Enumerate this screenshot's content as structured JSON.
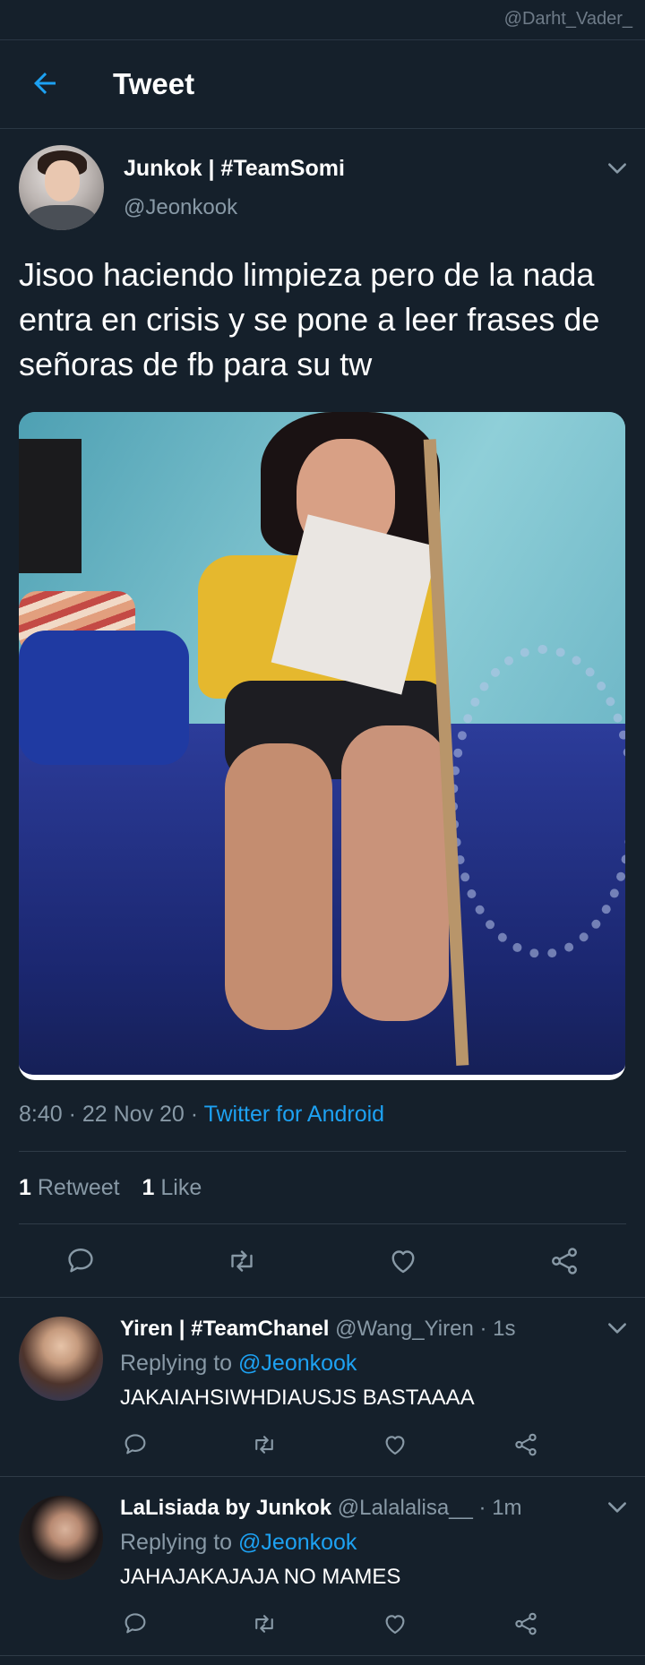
{
  "watermark": "@Darht_Vader_",
  "header": {
    "title": "Tweet",
    "back_icon": "arrow-left-icon"
  },
  "tweet": {
    "author_name": "Junkok | #TeamSomi",
    "author_handle": "@Jeonkook",
    "text": "Jisoo haciendo limpieza pero de la nada entra en crisis y se pone a leer frases de señoras de fb para su tw",
    "time": "8:40 · 22 Nov 20 · ",
    "source": "Twitter for Android",
    "retweets": "1",
    "retweets_label": "Retweet",
    "likes": "1",
    "likes_label": "Like"
  },
  "replies": [
    {
      "name": "Yiren | #TeamChanel",
      "handle": "@Wang_Yiren · 1s",
      "replying_prefix": "Replying to ",
      "replying_to": "@Jeonkook",
      "text": "JAKAIAHSIWHDIAUSJS BASTAAAA"
    },
    {
      "name": "LaLisiada by Junkok",
      "handle": "@Lalalalisa__ · 1m",
      "replying_prefix": "Replying to ",
      "replying_to": "@Jeonkook",
      "text": "JAHAJAKAJAJA NO MAMES"
    }
  ],
  "colors": {
    "background": "#15202b",
    "accent": "#1da1f2",
    "secondary_text": "#8899a6",
    "divider": "#2f3b47"
  },
  "icons": [
    "arrow-left-icon",
    "chevron-down-icon",
    "reply-icon",
    "retweet-icon",
    "like-icon",
    "share-icon"
  ]
}
